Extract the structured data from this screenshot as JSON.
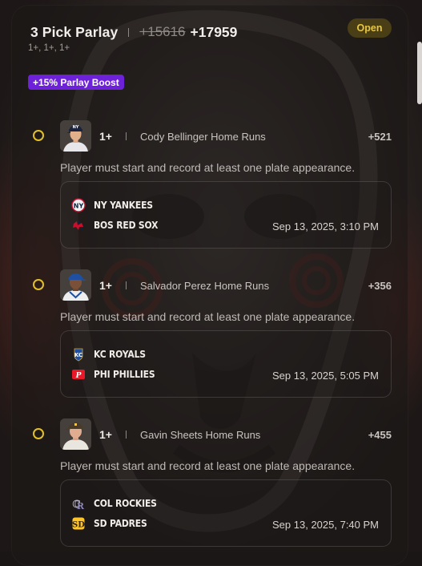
{
  "parlay": {
    "title": "3 Pick Parlay",
    "old_odds": "+15616",
    "new_odds": "+17959",
    "lines_summary": "1+, 1+, 1+",
    "status": "Open",
    "boost_label": "+15% Parlay Boost"
  },
  "legs": [
    {
      "line": "1+",
      "market": "Cody Bellinger Home Runs",
      "odds": "+521",
      "rule": "Player must start and record at least one plate appearance.",
      "team1": "NY YANKEES",
      "team2": "BOS RED SOX",
      "time": "Sep 13, 2025, 3:10 PM"
    },
    {
      "line": "1+",
      "market": "Salvador Perez Home Runs",
      "odds": "+356",
      "rule": "Player must start and record at least one plate appearance.",
      "team1": "KC ROYALS",
      "team2": "PHI PHILLIES",
      "time": "Sep 13, 2025, 5:05 PM"
    },
    {
      "line": "1+",
      "market": "Gavin Sheets Home Runs",
      "odds": "+455",
      "rule": "Player must start and record at least one plate appearance.",
      "team1": "COL ROCKIES",
      "team2": "SD PADRES",
      "time": "Sep 13, 2025, 7:40 PM"
    }
  ],
  "colors": {
    "accent_yellow": "#e2c02a",
    "boost_purple": "#6d22d9",
    "status_text": "#e8c640"
  }
}
